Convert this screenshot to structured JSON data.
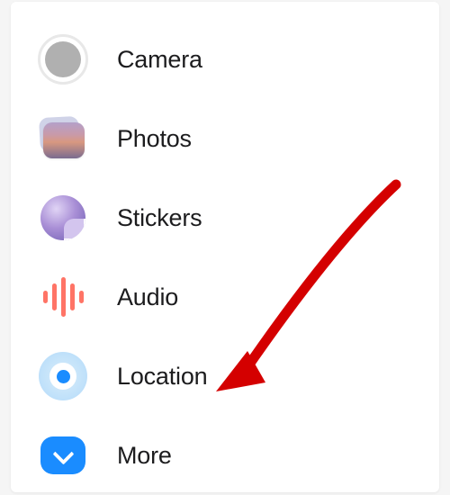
{
  "menu": {
    "items": [
      {
        "label": "Camera"
      },
      {
        "label": "Photos"
      },
      {
        "label": "Stickers"
      },
      {
        "label": "Audio"
      },
      {
        "label": "Location"
      },
      {
        "label": "More"
      }
    ]
  }
}
